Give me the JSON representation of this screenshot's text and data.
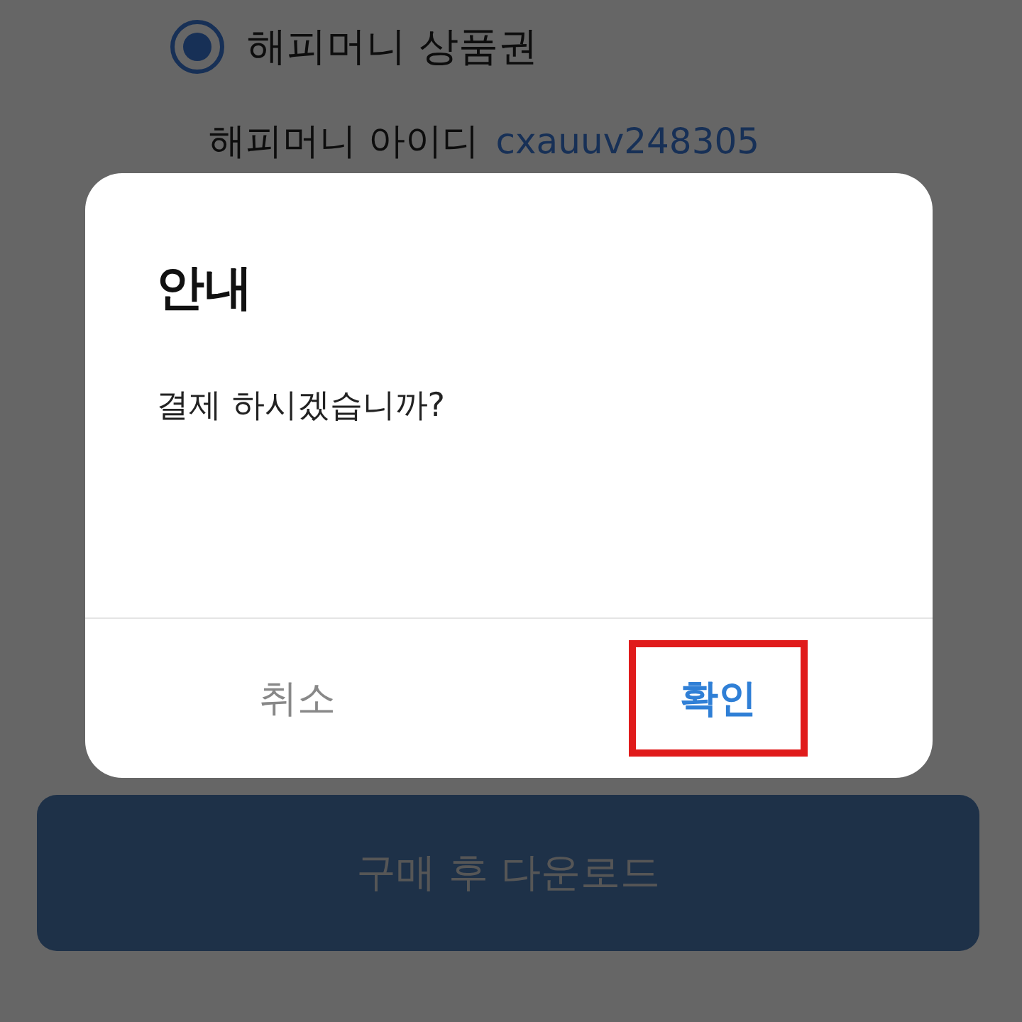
{
  "payment_options": [
    {
      "label": "해피머니 상품권",
      "selected": true
    }
  ],
  "account": {
    "label": "해피머니 아이디",
    "value": "cxauuv248305"
  },
  "dialog": {
    "title": "안내",
    "message": "결제 하시겠습니까?",
    "buttons": [
      {
        "label": "취소",
        "kind": "cancel",
        "highlighted": false
      },
      {
        "label": "확인",
        "kind": "confirm",
        "highlighted": true
      }
    ]
  },
  "purchase_button": {
    "label": "구매 후 다운로드"
  }
}
